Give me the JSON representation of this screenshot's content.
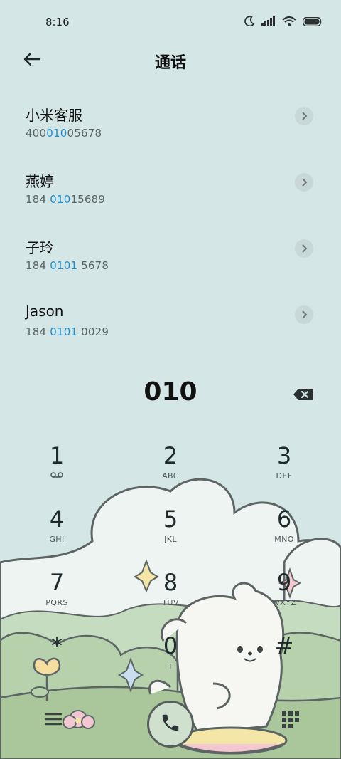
{
  "status_bar": {
    "time": "8:16",
    "icons": [
      "moon-icon",
      "signal-icon",
      "wifi-icon",
      "battery-icon"
    ]
  },
  "header": {
    "title": "通话",
    "back_icon": "back-arrow-icon"
  },
  "contacts": [
    {
      "name": "小米客服",
      "number_pre": "400",
      "number_match": "010",
      "number_post": "05678"
    },
    {
      "name": "燕婷",
      "number_pre": "184 ",
      "number_match": "010",
      "number_post": "15689"
    },
    {
      "name": "子玲",
      "number_pre": "184 ",
      "number_match": "0101",
      "number_post": " 5678"
    },
    {
      "name": "Jason",
      "number_pre": "184 ",
      "number_match": "0101",
      "number_post": " 0029"
    }
  ],
  "dialer": {
    "input": "010",
    "keys": [
      {
        "digit": "1",
        "letters": ""
      },
      {
        "digit": "2",
        "letters": "ABC"
      },
      {
        "digit": "3",
        "letters": "DEF"
      },
      {
        "digit": "4",
        "letters": "GHI"
      },
      {
        "digit": "5",
        "letters": "JKL"
      },
      {
        "digit": "6",
        "letters": "MNO"
      },
      {
        "digit": "7",
        "letters": "PQRS"
      },
      {
        "digit": "8",
        "letters": "TUV"
      },
      {
        "digit": "9",
        "letters": "WXYZ"
      },
      {
        "digit": "*",
        "letters": ""
      },
      {
        "digit": "0",
        "letters": "+"
      },
      {
        "digit": "#",
        "letters": ""
      }
    ]
  },
  "colors": {
    "background": "#d4e6e6",
    "highlight": "#1d8fd1",
    "grass": "#a9c79a"
  }
}
